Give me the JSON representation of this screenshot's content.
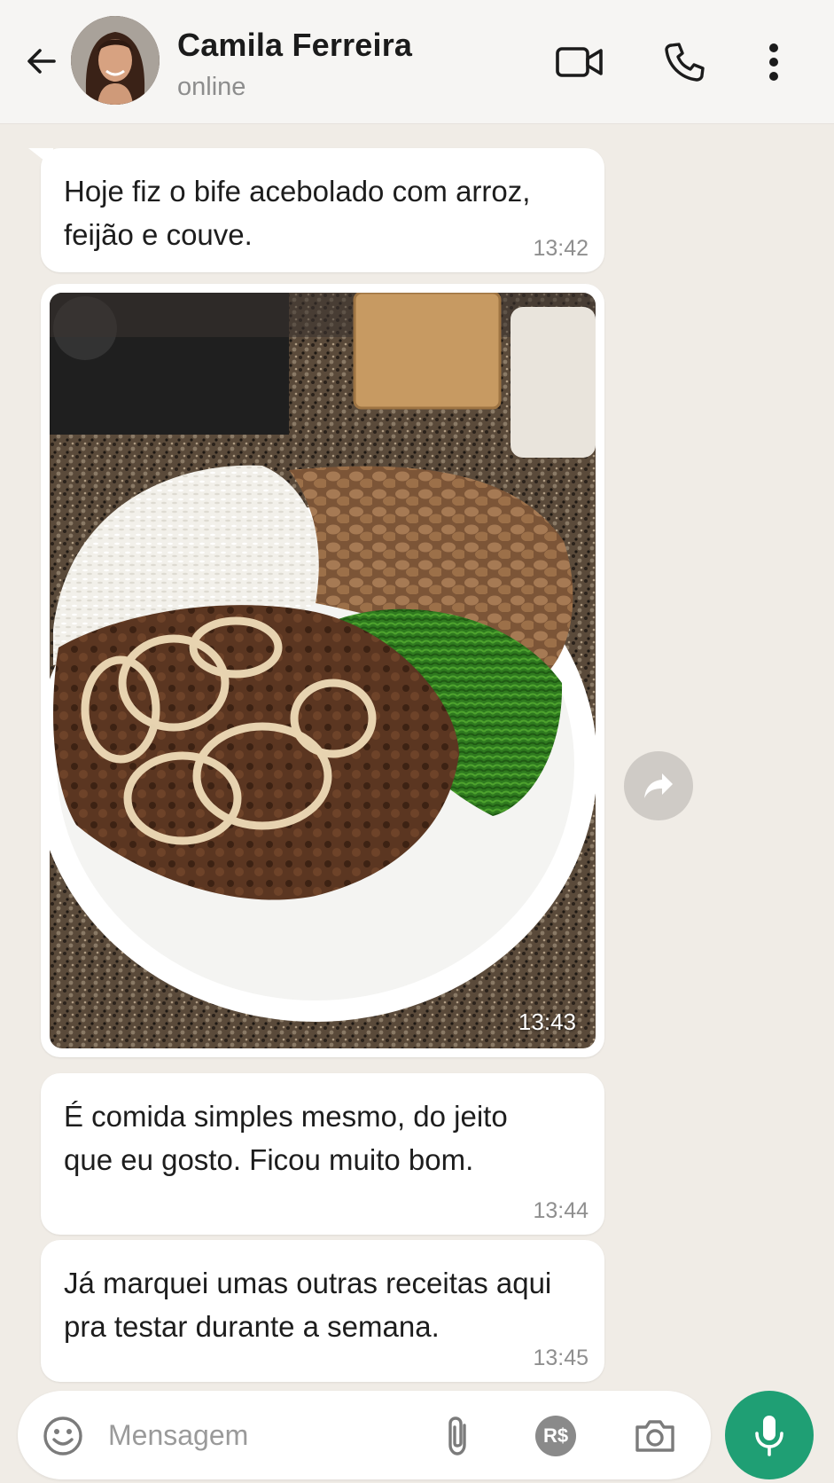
{
  "header": {
    "contact_name": "Camila Ferreira",
    "contact_status": "online",
    "icons": [
      "back-arrow-icon",
      "video-call-icon",
      "phone-icon",
      "more-vertical-icon"
    ]
  },
  "messages": [
    {
      "text": "Hoje fiz o bife acebolado com arroz, feijão e couve.",
      "time": "13:42"
    },
    {
      "type": "image",
      "time": "13:43"
    },
    {
      "text": "É comida simples mesmo, do jeito que eu gosto. Ficou muito bom.",
      "time": "13:44"
    },
    {
      "text": "Já marquei umas outras receitas aqui pra testar durante a semana.",
      "time": "13:45"
    }
  ],
  "composer": {
    "placeholder": "Mensagem",
    "pay_label": "R$",
    "icons": [
      "emoji-icon",
      "paperclip-icon",
      "pay-icon",
      "camera-icon",
      "mic-icon"
    ]
  },
  "colors": {
    "accent": "#1f9f74",
    "chat_background": "#f0ece6",
    "bubble": "#ffffff",
    "header": "#f6f5f3"
  }
}
